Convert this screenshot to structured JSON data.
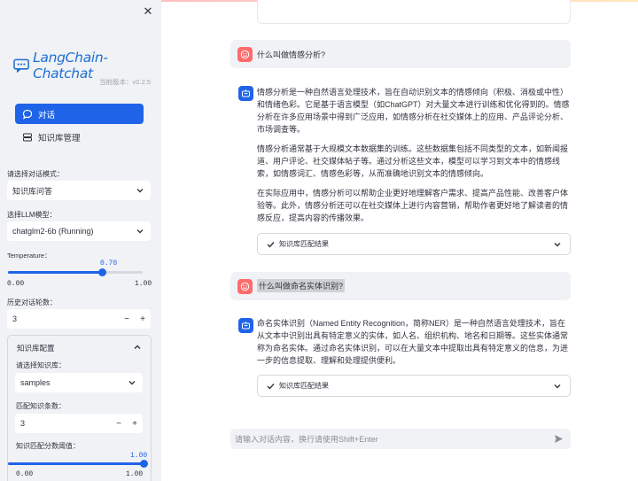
{
  "sidebar": {
    "brand": "LangChain-Chatchat",
    "version": "当前版本：v0.2.5",
    "menu": [
      {
        "label": "对话",
        "icon": "chat-bubble-icon",
        "active": true
      },
      {
        "label": "知识库管理",
        "icon": "database-icon",
        "active": false
      }
    ],
    "dialog_mode": {
      "label": "请选择对话模式：",
      "value": "知识库问答"
    },
    "llm_model": {
      "label": "选择LLM模型：",
      "value": "chatglm2-6b (Running)"
    },
    "temperature": {
      "label": "Temperature：",
      "value": "0.70",
      "min": "0.00",
      "max": "1.00",
      "fraction": 0.7
    },
    "history": {
      "label": "历史对话轮数：",
      "value": "3",
      "minus": "−",
      "plus": "+"
    },
    "kb_config": {
      "title": "知识库配置",
      "kb_label": "请选择知识库：",
      "kb_value": "samples",
      "match_label": "匹配知识条数：",
      "match_value": "3",
      "minus": "−",
      "plus": "+",
      "threshold_label": "知识匹配分数阈值：",
      "threshold_value": "1.00",
      "threshold_min": "0.00",
      "threshold_max": "1.00",
      "threshold_fraction": 1.0
    }
  },
  "chat": {
    "messages": [
      {
        "role": "user",
        "text": "什么叫做情感分析?"
      },
      {
        "role": "assistant",
        "paragraphs": [
          "情感分析是一种自然语言处理技术，旨在自动识别文本的情感倾向（积极、消极或中性）和情绪色彩。它是基于语言模型（如ChatGPT）对大量文本进行训练和优化得到的。情感分析在许多应用场景中得到广泛应用，如情感分析在社交媒体上的应用、产品评论分析、市场调查等。",
          "情感分析通常基于大规模文本数据集的训练。这些数据集包括不同类型的文本，如新闻报道、用户评论、社交媒体帖子等。通过分析这些文本，模型可以学习到文本中的情感线索，如情感词汇、情感色彩等，从而准确地识别文本的情感倾向。",
          "在实际应用中，情感分析可以帮助企业更好地理解客户需求、提高产品性能、改善客户体验等。此外，情感分析还可以在社交媒体上进行内容营销，帮助作者更好地了解读者的情感反应，提高内容的传播效果。"
        ],
        "expander": "知识库匹配结果"
      },
      {
        "role": "user",
        "text": "什么叫做命名实体识别?"
      },
      {
        "role": "assistant",
        "paragraphs": [
          "命名实体识别（Named Entity Recognition，简称NER）是一种自然语言处理技术，旨在从文本中识别出具有特定意义的实体，如人名、组织机构、地名和日期等。这些实体通常称为命名实体。通过命名实体识别，可以在大量文本中提取出具有特定意义的信息，为进一步的信息提取、理解和处理提供便利。"
        ],
        "expander": "知识库匹配结果"
      }
    ],
    "input_placeholder": "请输入对话内容，换行请使用Shift+Enter"
  },
  "colors": {
    "accent": "#1f63e8",
    "user_avatar": "#ff6b6b",
    "sidebar_bg": "#f0f2f6"
  }
}
